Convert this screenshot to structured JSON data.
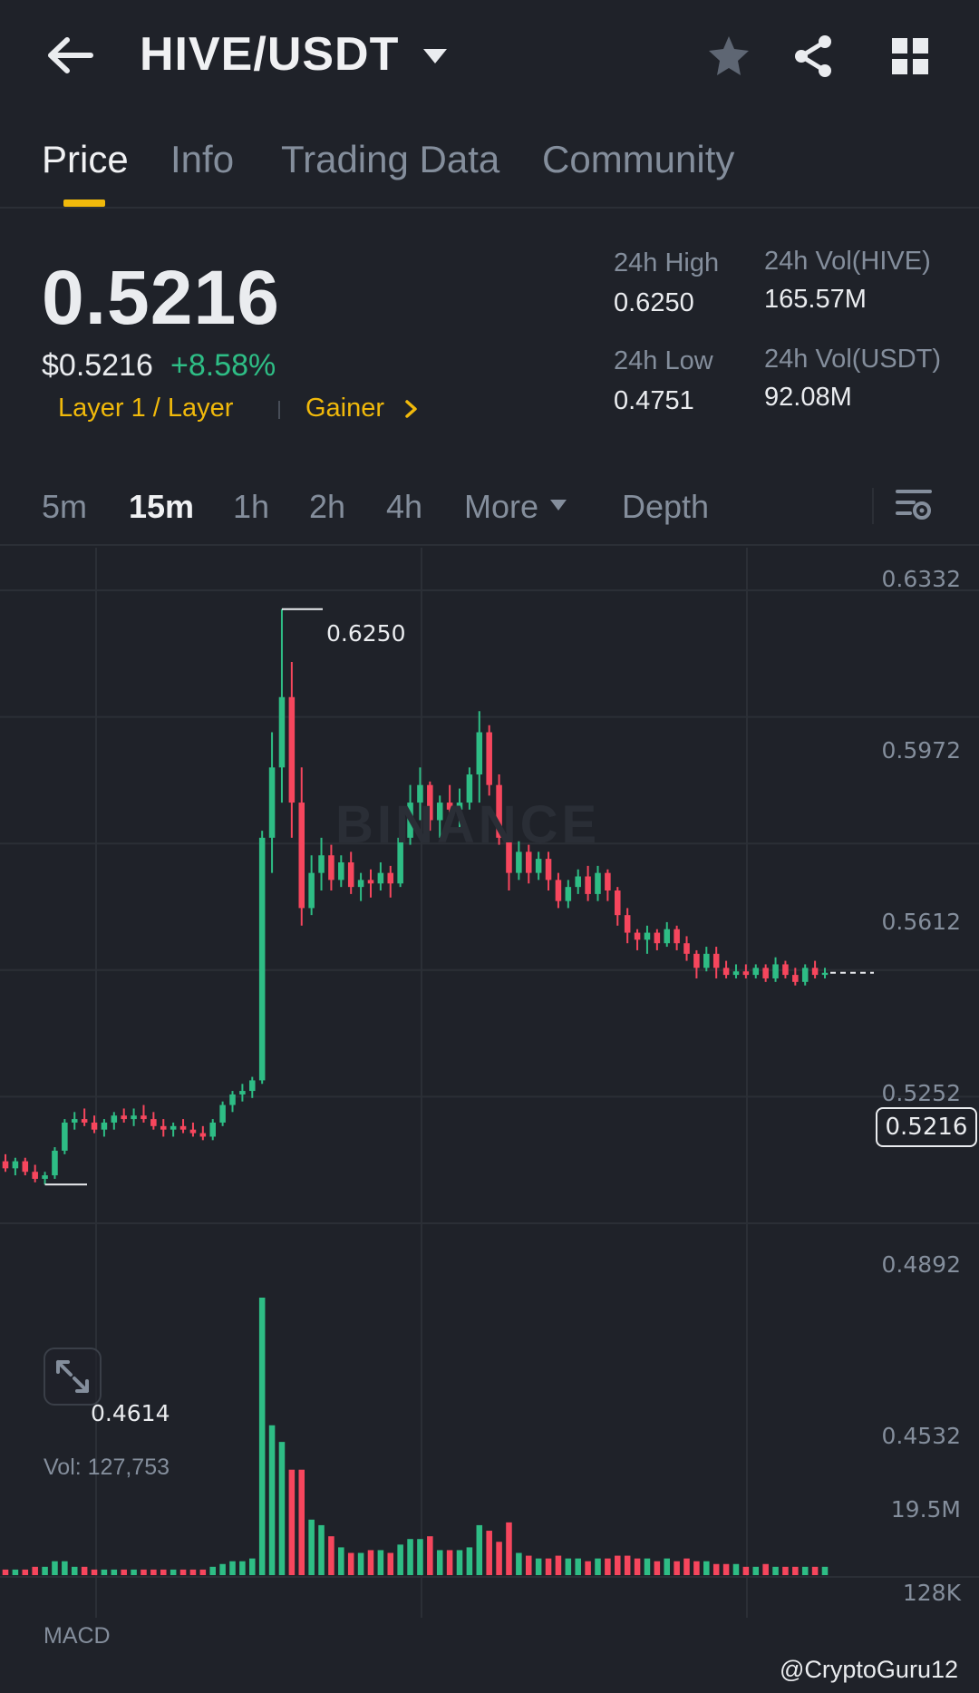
{
  "header": {
    "pair": "HIVE/USDT",
    "icons": [
      "back-arrow-icon",
      "caret-down-icon",
      "star-icon",
      "share-icon",
      "grid-icon"
    ]
  },
  "tabs": [
    {
      "label": "Price",
      "active": true
    },
    {
      "label": "Info",
      "active": false
    },
    {
      "label": "Trading Data",
      "active": false
    },
    {
      "label": "Community",
      "active": false
    }
  ],
  "ticker": {
    "last_price": "0.5216",
    "usd_price": "$0.5216",
    "change": "+8.58%",
    "tag_layer": "Layer 1 / Layer",
    "tag_gainer": "Gainer",
    "stats": {
      "high_label": "24h High",
      "high_value": "0.6250",
      "low_label": "24h Low",
      "low_value": "0.4751",
      "vol_base_label": "24h Vol(HIVE)",
      "vol_base_value": "165.57M",
      "vol_quote_label": "24h Vol(USDT)",
      "vol_quote_value": "92.08M"
    }
  },
  "intervals": [
    {
      "label": "5m",
      "active": false
    },
    {
      "label": "15m",
      "active": true
    },
    {
      "label": "1h",
      "active": false
    },
    {
      "label": "2h",
      "active": false
    },
    {
      "label": "4h",
      "active": false
    },
    {
      "label": "More",
      "active": false
    },
    {
      "label": "Depth",
      "active": false
    }
  ],
  "chart": {
    "y_labels": [
      "0.6332",
      "0.5972",
      "0.5612",
      "0.5252",
      "0.4892",
      "0.4532"
    ],
    "high_marker": "0.6250",
    "low_marker": "0.4614",
    "current_price": "0.5216",
    "vol_label": "Vol: 127,753",
    "vol_axis": [
      "19.5M",
      "128K"
    ],
    "macd_label": "MACD",
    "watermark": "BINANCE",
    "credit": "@CryptoGuru12",
    "up_color": "#2ebd85",
    "down_color": "#f6465d"
  },
  "chart_data": {
    "type": "candlestick",
    "interval": "15m",
    "ylim": [
      0.4532,
      0.6332
    ],
    "candles": [
      [
        0.468,
        0.47,
        0.465,
        0.466
      ],
      [
        0.466,
        0.469,
        0.464,
        0.468
      ],
      [
        0.468,
        0.469,
        0.464,
        0.465
      ],
      [
        0.465,
        0.467,
        0.462,
        0.463
      ],
      [
        0.463,
        0.465,
        0.4614,
        0.464
      ],
      [
        0.464,
        0.472,
        0.463,
        0.471
      ],
      [
        0.471,
        0.48,
        0.47,
        0.479
      ],
      [
        0.479,
        0.482,
        0.477,
        0.48
      ],
      [
        0.48,
        0.483,
        0.478,
        0.479
      ],
      [
        0.479,
        0.481,
        0.476,
        0.477
      ],
      [
        0.477,
        0.48,
        0.475,
        0.479
      ],
      [
        0.479,
        0.482,
        0.477,
        0.481
      ],
      [
        0.481,
        0.483,
        0.479,
        0.48
      ],
      [
        0.48,
        0.483,
        0.478,
        0.481
      ],
      [
        0.481,
        0.484,
        0.479,
        0.48
      ],
      [
        0.48,
        0.482,
        0.477,
        0.478
      ],
      [
        0.478,
        0.48,
        0.475,
        0.477
      ],
      [
        0.477,
        0.479,
        0.475,
        0.478
      ],
      [
        0.478,
        0.48,
        0.476,
        0.477
      ],
      [
        0.477,
        0.479,
        0.475,
        0.476
      ],
      [
        0.476,
        0.478,
        0.474,
        0.475
      ],
      [
        0.475,
        0.48,
        0.474,
        0.479
      ],
      [
        0.479,
        0.485,
        0.478,
        0.484
      ],
      [
        0.484,
        0.488,
        0.482,
        0.487
      ],
      [
        0.487,
        0.49,
        0.485,
        0.488
      ],
      [
        0.488,
        0.492,
        0.486,
        0.491
      ],
      [
        0.491,
        0.562,
        0.49,
        0.56
      ],
      [
        0.56,
        0.59,
        0.55,
        0.58
      ],
      [
        0.58,
        0.625,
        0.57,
        0.6
      ],
      [
        0.6,
        0.61,
        0.56,
        0.57
      ],
      [
        0.57,
        0.58,
        0.535,
        0.54
      ],
      [
        0.54,
        0.555,
        0.538,
        0.55
      ],
      [
        0.55,
        0.56,
        0.545,
        0.555
      ],
      [
        0.555,
        0.558,
        0.545,
        0.548
      ],
      [
        0.548,
        0.555,
        0.546,
        0.553
      ],
      [
        0.553,
        0.556,
        0.544,
        0.546
      ],
      [
        0.546,
        0.55,
        0.542,
        0.548
      ],
      [
        0.548,
        0.551,
        0.543,
        0.547
      ],
      [
        0.547,
        0.553,
        0.545,
        0.55
      ],
      [
        0.55,
        0.552,
        0.543,
        0.547
      ],
      [
        0.547,
        0.562,
        0.546,
        0.56
      ],
      [
        0.56,
        0.575,
        0.558,
        0.57
      ],
      [
        0.57,
        0.58,
        0.565,
        0.575
      ],
      [
        0.575,
        0.576,
        0.562,
        0.565
      ],
      [
        0.565,
        0.572,
        0.56,
        0.57
      ],
      [
        0.57,
        0.575,
        0.564,
        0.568
      ],
      [
        0.568,
        0.574,
        0.563,
        0.57
      ],
      [
        0.57,
        0.58,
        0.568,
        0.578
      ],
      [
        0.578,
        0.596,
        0.57,
        0.59
      ],
      [
        0.59,
        0.592,
        0.572,
        0.575
      ],
      [
        0.575,
        0.578,
        0.558,
        0.56
      ],
      [
        0.56,
        0.562,
        0.545,
        0.55
      ],
      [
        0.55,
        0.559,
        0.548,
        0.556
      ],
      [
        0.556,
        0.558,
        0.547,
        0.55
      ],
      [
        0.55,
        0.556,
        0.548,
        0.554
      ],
      [
        0.554,
        0.556,
        0.545,
        0.548
      ],
      [
        0.548,
        0.55,
        0.54,
        0.542
      ],
      [
        0.542,
        0.548,
        0.54,
        0.546
      ],
      [
        0.546,
        0.551,
        0.544,
        0.549
      ],
      [
        0.549,
        0.552,
        0.542,
        0.544
      ],
      [
        0.544,
        0.552,
        0.542,
        0.55
      ],
      [
        0.55,
        0.551,
        0.542,
        0.545
      ],
      [
        0.545,
        0.546,
        0.535,
        0.538
      ],
      [
        0.538,
        0.54,
        0.53,
        0.533
      ],
      [
        0.533,
        0.534,
        0.528,
        0.531
      ],
      [
        0.531,
        0.535,
        0.527,
        0.533
      ],
      [
        0.533,
        0.534,
        0.528,
        0.53
      ],
      [
        0.53,
        0.536,
        0.529,
        0.534
      ],
      [
        0.534,
        0.535,
        0.528,
        0.53
      ],
      [
        0.53,
        0.532,
        0.525,
        0.527
      ],
      [
        0.527,
        0.528,
        0.52,
        0.523
      ],
      [
        0.523,
        0.529,
        0.522,
        0.527
      ],
      [
        0.527,
        0.529,
        0.52,
        0.523
      ],
      [
        0.523,
        0.525,
        0.52,
        0.521
      ],
      [
        0.521,
        0.524,
        0.52,
        0.522
      ],
      [
        0.522,
        0.524,
        0.52,
        0.521
      ],
      [
        0.521,
        0.524,
        0.52,
        0.523
      ],
      [
        0.523,
        0.524,
        0.519,
        0.52
      ],
      [
        0.52,
        0.526,
        0.519,
        0.524
      ],
      [
        0.524,
        0.525,
        0.52,
        0.521
      ],
      [
        0.521,
        0.523,
        0.518,
        0.519
      ],
      [
        0.519,
        0.524,
        0.518,
        0.523
      ],
      [
        0.523,
        0.525,
        0.52,
        0.521
      ],
      [
        0.521,
        0.523,
        0.52,
        0.5216
      ]
    ],
    "volumes": [
      0.02,
      0.02,
      0.02,
      0.03,
      0.03,
      0.05,
      0.05,
      0.03,
      0.03,
      0.02,
      0.02,
      0.02,
      0.02,
      0.02,
      0.02,
      0.02,
      0.02,
      0.02,
      0.02,
      0.02,
      0.02,
      0.03,
      0.04,
      0.05,
      0.05,
      0.06,
      1.0,
      0.54,
      0.48,
      0.38,
      0.38,
      0.2,
      0.18,
      0.14,
      0.1,
      0.08,
      0.08,
      0.09,
      0.09,
      0.08,
      0.11,
      0.13,
      0.13,
      0.14,
      0.09,
      0.09,
      0.09,
      0.1,
      0.18,
      0.16,
      0.12,
      0.19,
      0.08,
      0.07,
      0.06,
      0.06,
      0.07,
      0.06,
      0.06,
      0.05,
      0.06,
      0.06,
      0.07,
      0.07,
      0.06,
      0.06,
      0.05,
      0.06,
      0.05,
      0.06,
      0.05,
      0.05,
      0.04,
      0.04,
      0.04,
      0.03,
      0.03,
      0.04,
      0.03,
      0.03,
      0.03,
      0.03,
      0.03,
      0.03
    ]
  }
}
